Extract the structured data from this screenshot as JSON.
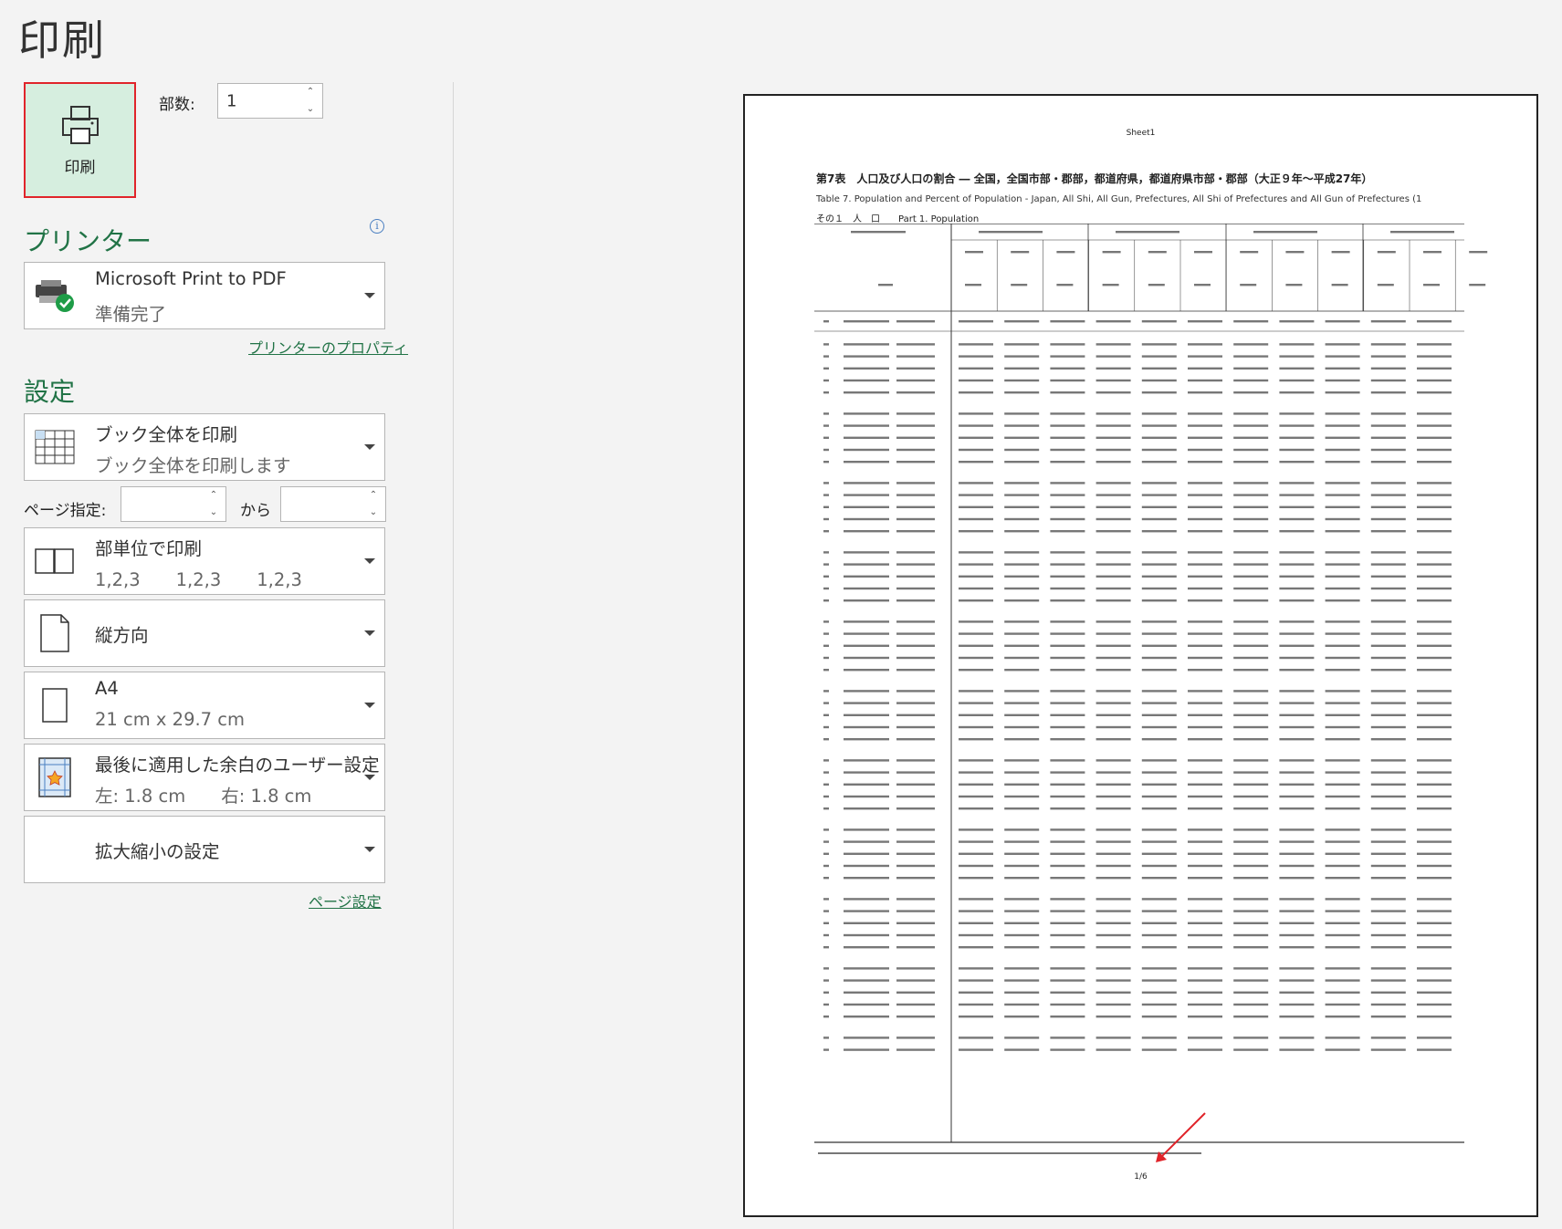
{
  "backstage": {
    "title": "印刷",
    "print_button_label": "印刷",
    "copies_label": "部数:",
    "copies_value": "1",
    "printer_heading": "プリンター",
    "printer": {
      "name": "Microsoft Print to PDF",
      "status": "準備完了"
    },
    "printer_properties_link": "プリンターのプロパティ",
    "settings_heading": "設定",
    "settings": [
      {
        "line1": "ブック全体を印刷",
        "line2": "ブック全体を印刷します"
      },
      {
        "line1": "部単位で印刷",
        "line2": "1,2,3　　1,2,3　　1,2,3"
      },
      {
        "line1": "縦方向",
        "line2": ""
      },
      {
        "line1": "A4",
        "line2": "21 cm x 29.7 cm"
      },
      {
        "line1": "最後に適用した余白のユーザー設定",
        "line2": "左:  1.8 cm　　右:  1.8 cm"
      },
      {
        "line1": "拡大縮小の設定",
        "line2": ""
      }
    ],
    "pages_label": "ページ指定:",
    "pages_from": "",
    "pages_to_label": "から",
    "pages_to": "",
    "page_setup_link": "ページ設定"
  },
  "preview": {
    "sheet_name": "Sheet1",
    "title_ja": "第7表　人口及び人口の割合 ― 全国，全国市部・郡部，都道府県，都道府県市部・郡部（大正９年～平成27年）",
    "title_en": "Table 7.  Population and Percent of Population - Japan, All Shi, All Gun, Prefectures, All Shi of Prefectures and All Gun of Prefectures  (1",
    "part": "その１　人　口　　Part 1.  Population",
    "page_number": "1/6"
  }
}
